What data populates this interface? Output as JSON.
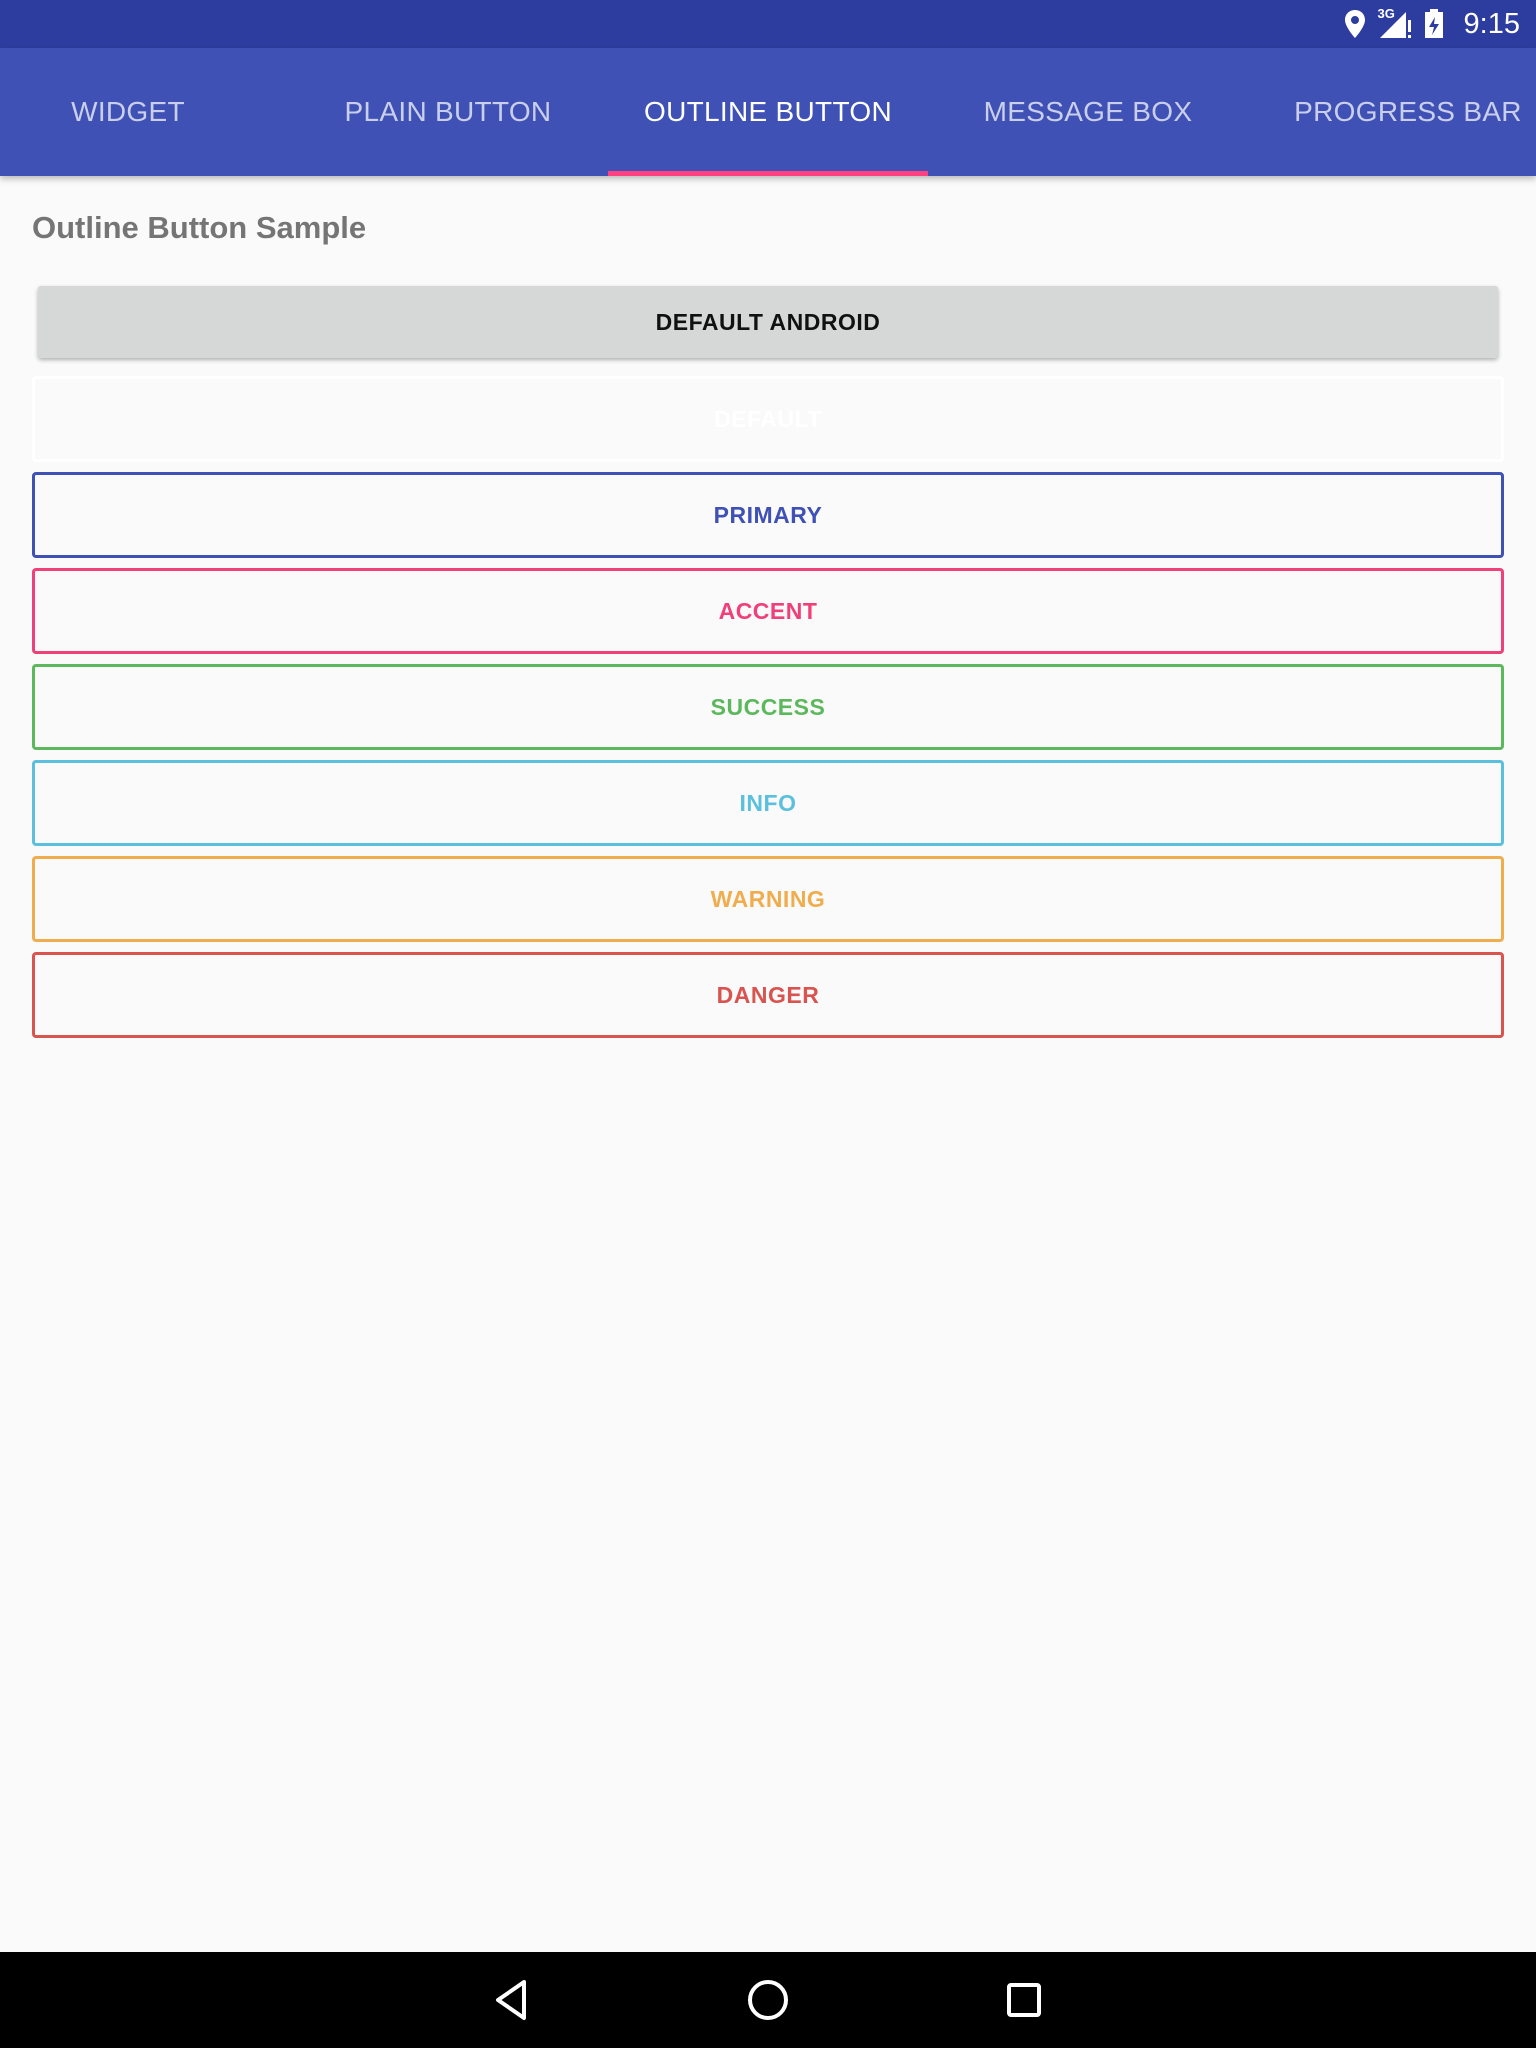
{
  "status_bar": {
    "time": "9:15",
    "network_label": "3G",
    "icons": [
      "location-icon",
      "signal-icon",
      "battery-icon"
    ]
  },
  "tabs": [
    {
      "label": "WIDGET",
      "active": false
    },
    {
      "label": "PLAIN BUTTON",
      "active": false
    },
    {
      "label": "OUTLINE BUTTON",
      "active": true
    },
    {
      "label": "MESSAGE BOX",
      "active": false
    },
    {
      "label": "PROGRESS BAR",
      "active": false
    }
  ],
  "content": {
    "title": "Outline Button Sample",
    "buttons": {
      "android": "DEFAULT ANDROID",
      "default": "DEFAULT",
      "primary": "PRIMARY",
      "accent": "ACCENT",
      "success": "SUCCESS",
      "info": "INFO",
      "warning": "WARNING",
      "danger": "DANGER"
    }
  },
  "colors": {
    "status_bar": "#2d3d9f",
    "app_bar": "#3f51b5",
    "tab_indicator": "#ff4081",
    "primary": "#3f51b5",
    "accent": "#f0407a",
    "success": "#5cb85c",
    "info": "#5bc0de",
    "warning": "#f0ad4e",
    "danger": "#d9534f",
    "background": "#fafafa"
  },
  "nav_bar": {
    "icons": [
      "back-icon",
      "home-icon",
      "recents-icon"
    ]
  }
}
